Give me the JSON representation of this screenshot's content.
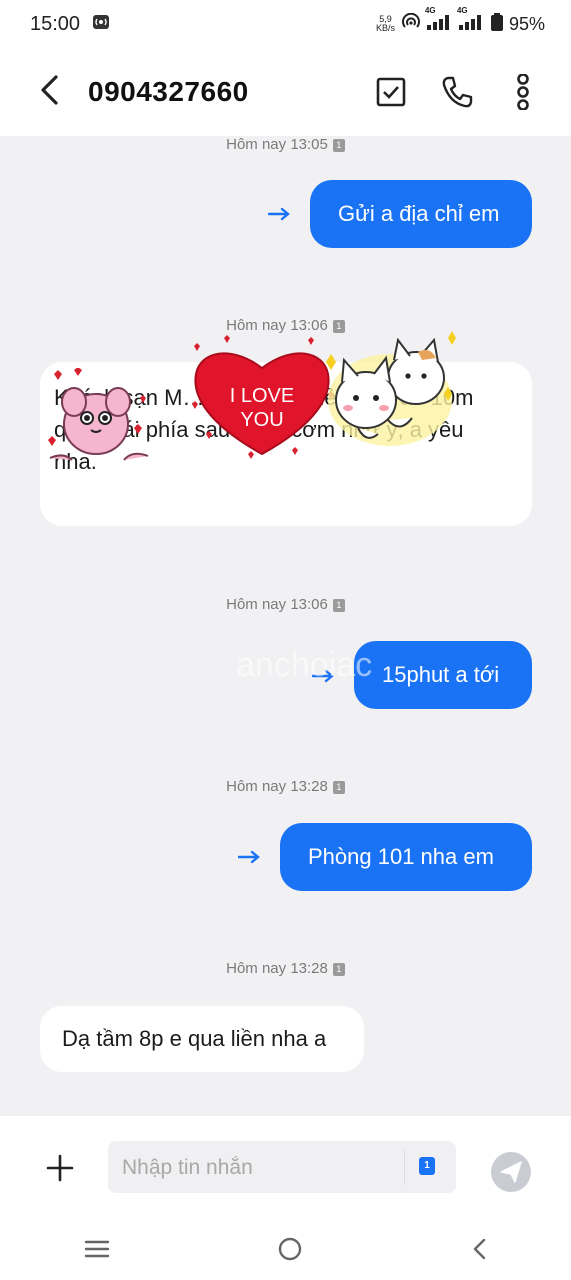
{
  "status_bar": {
    "time": "15:00",
    "net_speed": "5,9",
    "net_unit": "KB/s",
    "net1": "4G",
    "net2": "4G",
    "battery": "95%"
  },
  "header": {
    "contact": "0904327660"
  },
  "messages": [
    {
      "timestamp": "Hôm nay 13:05",
      "sim": "1",
      "direction": "out",
      "text": "Gửi a địa chỉ em"
    },
    {
      "timestamp": "Hôm nay 13:06",
      "sim": "1",
      "direction": "in",
      "text": "Khách sạn M… hẻm 14… hẻm … vào 10m quẹo trái phía sau quán cơm như ý, a yêu nha."
    },
    {
      "timestamp": "Hôm nay 13:06",
      "sim": "1",
      "direction": "out",
      "text": "15phut a tới"
    },
    {
      "timestamp": "Hôm nay 13:28",
      "sim": "1",
      "direction": "out",
      "text": "Phòng 101 nha em"
    },
    {
      "timestamp": "Hôm nay 13:28",
      "sim": "1",
      "direction": "in",
      "text": "Dạ tầm 8p e qua liền nha a"
    }
  ],
  "stickers": {
    "heart_text_1": "I LOVE",
    "heart_text_2": "YOU"
  },
  "watermark": "anchoiac",
  "composer": {
    "placeholder": "Nhập tin nhắn",
    "sim": "1"
  },
  "colors": {
    "accent": "#1a73f5",
    "background": "#f1f1f3",
    "heart": "#e0142a"
  }
}
